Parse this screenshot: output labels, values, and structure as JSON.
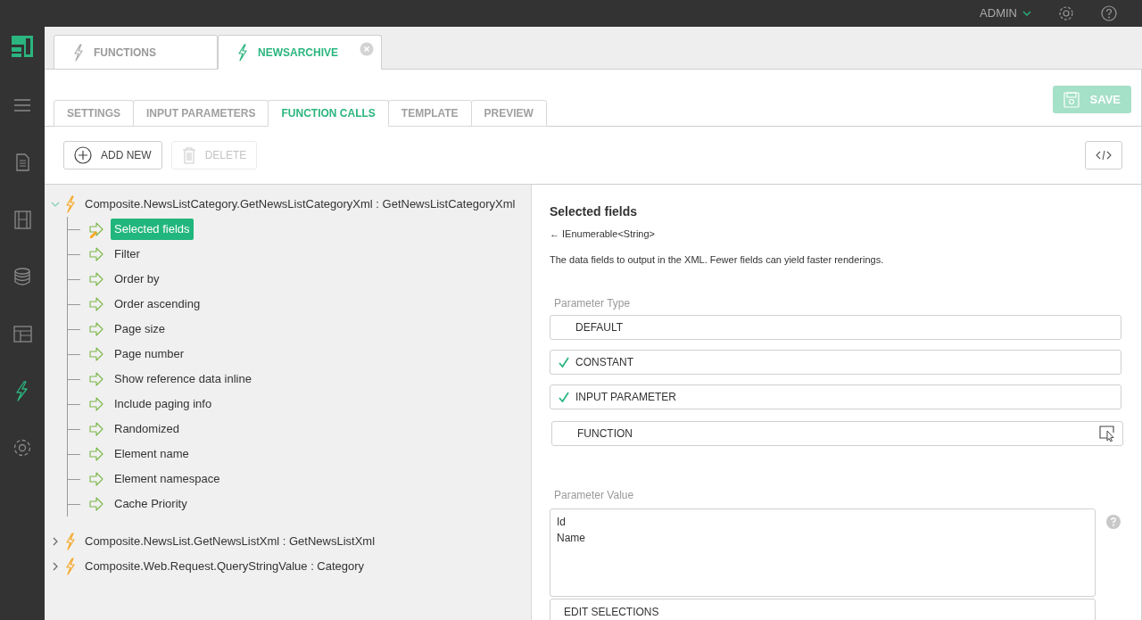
{
  "topbar": {
    "user": "ADMIN"
  },
  "sidebar": {
    "items": [
      {
        "kind": "menu",
        "selected": false
      },
      {
        "kind": "document",
        "selected": false
      },
      {
        "kind": "film",
        "selected": false
      },
      {
        "kind": "database",
        "selected": false
      },
      {
        "kind": "layout",
        "selected": false
      },
      {
        "kind": "function",
        "selected": true
      },
      {
        "kind": "settings",
        "selected": false
      }
    ]
  },
  "doc_tabs": [
    {
      "label": "FUNCTIONS",
      "selected": false,
      "closable": false
    },
    {
      "label": "NEWSARCHIVE",
      "selected": true,
      "closable": true
    }
  ],
  "sub_tabs": [
    {
      "label": "SETTINGS",
      "selected": false
    },
    {
      "label": "INPUT PARAMETERS",
      "selected": false
    },
    {
      "label": "FUNCTION CALLS",
      "selected": true
    },
    {
      "label": "TEMPLATE",
      "selected": false
    },
    {
      "label": "PREVIEW",
      "selected": false
    }
  ],
  "save_button": {
    "label": "SAVE",
    "disabled": true
  },
  "toolbar": {
    "buttons": [
      {
        "kind": "add",
        "label": "ADD NEW",
        "disabled": false
      },
      {
        "kind": "delete",
        "label": "DELETE",
        "disabled": true
      }
    ]
  },
  "tree": [
    {
      "label": "Composite.NewsListCategory.GetNewsListCategoryXml : GetNewsListCategoryXml",
      "expanded": true,
      "children": [
        {
          "label": "Selected fields",
          "selected": true
        },
        {
          "label": "Filter",
          "selected": false
        },
        {
          "label": "Order by",
          "selected": false
        },
        {
          "label": "Order ascending",
          "selected": false
        },
        {
          "label": "Page size",
          "selected": false
        },
        {
          "label": "Page number",
          "selected": false
        },
        {
          "label": "Show reference data inline",
          "selected": false
        },
        {
          "label": "Include paging info",
          "selected": false
        },
        {
          "label": "Randomized",
          "selected": false
        },
        {
          "label": "Element name",
          "selected": false
        },
        {
          "label": "Element namespace",
          "selected": false
        },
        {
          "label": "Cache Priority",
          "selected": false
        }
      ]
    },
    {
      "label": "Composite.NewsList.GetNewsListXml : GetNewsListXml",
      "expanded": false
    },
    {
      "label": "Composite.Web.Request.QueryStringValue : Category",
      "expanded": false
    }
  ],
  "detail": {
    "title": "Selected fields",
    "return_type": "← IEnumerable<String>",
    "description": "The data fields to output in the XML. Fewer fields can yield faster renderings.",
    "parameter_type": {
      "label": "Parameter Type",
      "options": [
        {
          "kind": "plain",
          "label": "DEFAULT",
          "checked": false
        },
        {
          "kind": "plain",
          "label": "CONSTANT",
          "checked": true
        },
        {
          "kind": "plain",
          "label": "INPUT PARAMETER",
          "checked": true
        },
        {
          "kind": "picker",
          "label": "FUNCTION",
          "checked": false
        }
      ]
    },
    "parameter_value": {
      "label": "Parameter Value",
      "lines": [
        "Id",
        "Name"
      ],
      "edit_button": "EDIT SELECTIONS"
    }
  }
}
